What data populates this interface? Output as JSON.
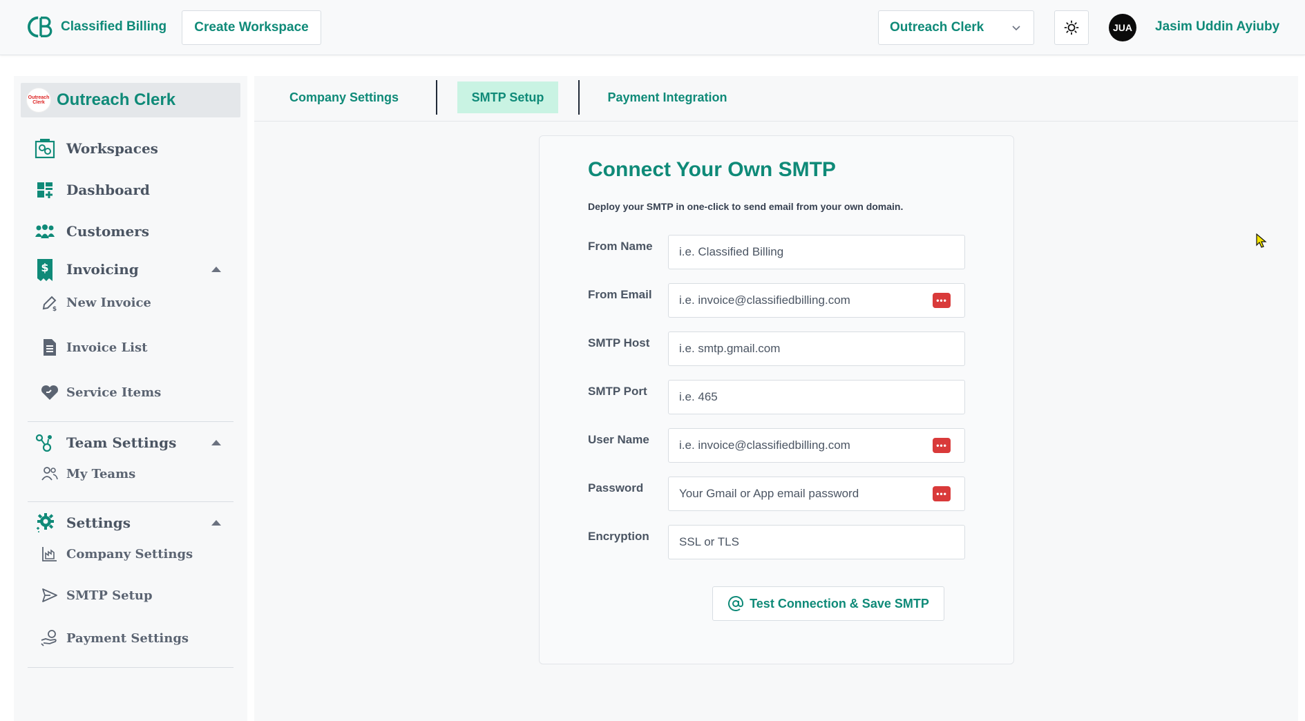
{
  "header": {
    "brand": "Classified Billing",
    "create_workspace": "Create Workspace",
    "workspace_selected": "Outreach Clerk",
    "avatar_initials": "JUA",
    "user_name": "Jasim Uddin Ayiuby"
  },
  "sidebar": {
    "org_logo_text": "Outreach Clerk",
    "org_name": "Outreach Clerk",
    "items": {
      "workspaces": "Workspaces",
      "dashboard": "Dashboard",
      "customers": "Customers",
      "invoicing": "Invoicing",
      "new_invoice": "New Invoice",
      "invoice_list": "Invoice List",
      "service_items": "Service Items",
      "team_settings": "Team Settings",
      "my_teams": "My Teams",
      "settings": "Settings",
      "company_settings": "Company Settings",
      "smtp_setup": "SMTP Setup",
      "payment_settings": "Payment Settings"
    }
  },
  "tabs": {
    "company_settings": "Company Settings",
    "smtp_setup": "SMTP Setup",
    "payment_integration": "Payment Integration"
  },
  "form": {
    "title": "Connect Your Own SMTP",
    "subtitle": "Deploy your SMTP in one-click to send email from your own domain.",
    "from_name": {
      "label": "From Name",
      "placeholder": "i.e. Classified Billing"
    },
    "from_email": {
      "label": "From Email",
      "placeholder": "i.e. invoice@classifiedbilling.com"
    },
    "smtp_host": {
      "label": "SMTP Host",
      "placeholder": "i.e. smtp.gmail.com"
    },
    "smtp_port": {
      "label": "SMTP Port",
      "placeholder": "i.e. 465"
    },
    "user_name": {
      "label": "User Name",
      "placeholder": "i.e. invoice@classifiedbilling.com"
    },
    "password": {
      "label": "Password",
      "placeholder": "Your Gmail or App email password"
    },
    "encryption": {
      "label": "Encryption",
      "placeholder": "SSL or TLS"
    },
    "submit": "Test Connection & Save SMTP"
  },
  "colors": {
    "accent": "#0f8a78",
    "active_tab_bg": "#c9f3e3",
    "password_manager": "#d93a3a"
  }
}
